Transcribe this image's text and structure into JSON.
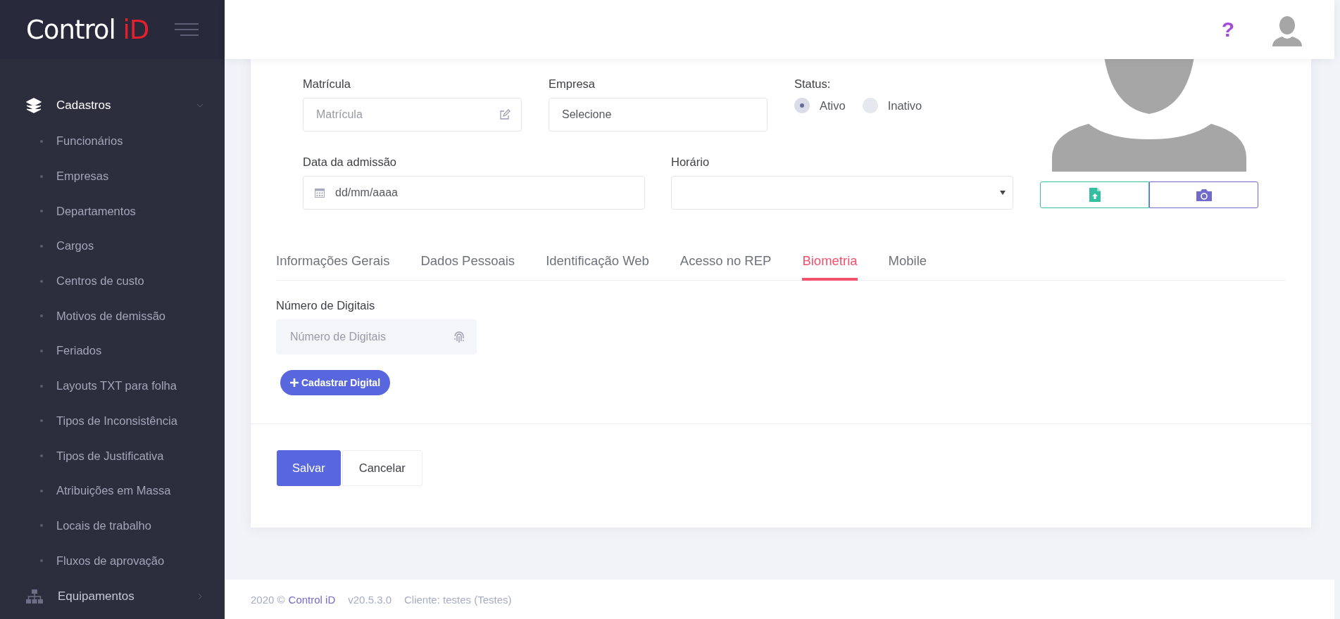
{
  "sidebar": {
    "logo": {
      "text": "Control",
      "accent": "iD"
    },
    "sections": [
      {
        "label": "Cadastros",
        "expanded": true,
        "children": [
          {
            "label": "Funcionários"
          },
          {
            "label": "Empresas"
          },
          {
            "label": "Departamentos"
          },
          {
            "label": "Cargos"
          },
          {
            "label": "Centros de custo"
          },
          {
            "label": "Motivos de demissão"
          },
          {
            "label": "Feriados"
          },
          {
            "label": "Layouts TXT para folha"
          },
          {
            "label": "Tipos de Inconsistência"
          },
          {
            "label": "Tipos de Justificativa"
          },
          {
            "label": "Atribuições em Massa"
          },
          {
            "label": "Locais de trabalho"
          },
          {
            "label": "Fluxos de aprovação"
          }
        ]
      },
      {
        "label": "Equipamentos",
        "expanded": false
      }
    ]
  },
  "header": {
    "help": "?"
  },
  "form": {
    "rows": [
      [
        {
          "kind": "text",
          "label": "Matrícula",
          "placeholder": "Matrícula"
        },
        {
          "kind": "select",
          "label": "Empresa",
          "value": "Selecione"
        },
        {
          "kind": "radio",
          "label": "Status:",
          "options": [
            {
              "label": "Ativo",
              "selected": true
            },
            {
              "label": "Inativo",
              "selected": false
            }
          ]
        }
      ],
      [
        {
          "kind": "date",
          "label": "Data da admissão",
          "placeholder": "dd/mm/aaaa"
        },
        {
          "kind": "dropdown",
          "label": "Horário"
        }
      ]
    ]
  },
  "tabs": [
    {
      "label": "Informações Gerais",
      "selected": false
    },
    {
      "label": "Dados Pessoais",
      "selected": false
    },
    {
      "label": "Identificação Web",
      "selected": false
    },
    {
      "label": "Acesso no REP",
      "selected": false
    },
    {
      "label": "Biometria",
      "selected": true
    },
    {
      "label": "Mobile",
      "selected": false
    }
  ],
  "biometria": {
    "label": "Número de Digitais",
    "placeholder": "Número de Digitais",
    "button": "Cadastrar Digital"
  },
  "actions": [
    {
      "label": "Salvar",
      "kind": "primary"
    },
    {
      "label": "Cancelar",
      "kind": "secondary"
    }
  ],
  "footer": {
    "year": "2020 ©",
    "link": "Control iD",
    "version": "v20.5.3.0",
    "client": "Cliente: testes (Testes)"
  }
}
